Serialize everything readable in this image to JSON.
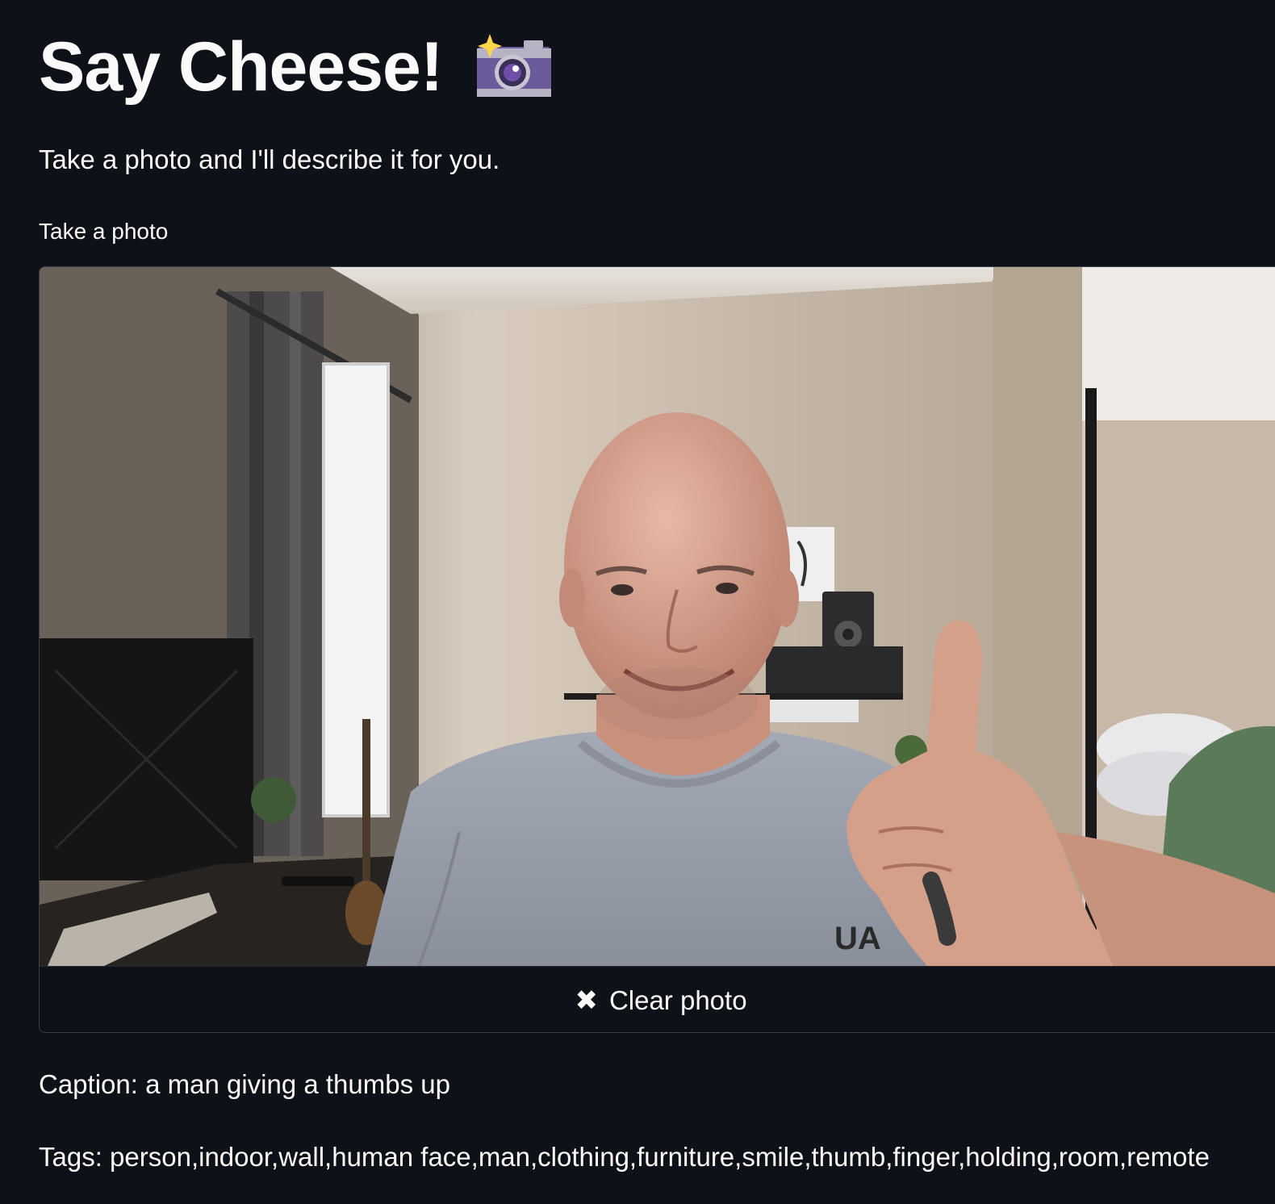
{
  "header": {
    "title": "Say Cheese!",
    "title_icon": "camera-with-flash-icon"
  },
  "intro": {
    "text": "Take a photo and I'll describe it for you."
  },
  "camera_input": {
    "label": "Take a photo",
    "clear_button_label": "Clear photo",
    "clear_icon": "close-icon"
  },
  "results": {
    "caption_text": "Caption: a man giving a thumbs up",
    "tags_text": "Tags: person,indoor,wall,human face,man,clothing,furniture,smile,thumb,finger,holding,room,remote"
  },
  "colors": {
    "background": "#0e1117",
    "text": "#fafafa",
    "border": "#3b3f4a"
  }
}
